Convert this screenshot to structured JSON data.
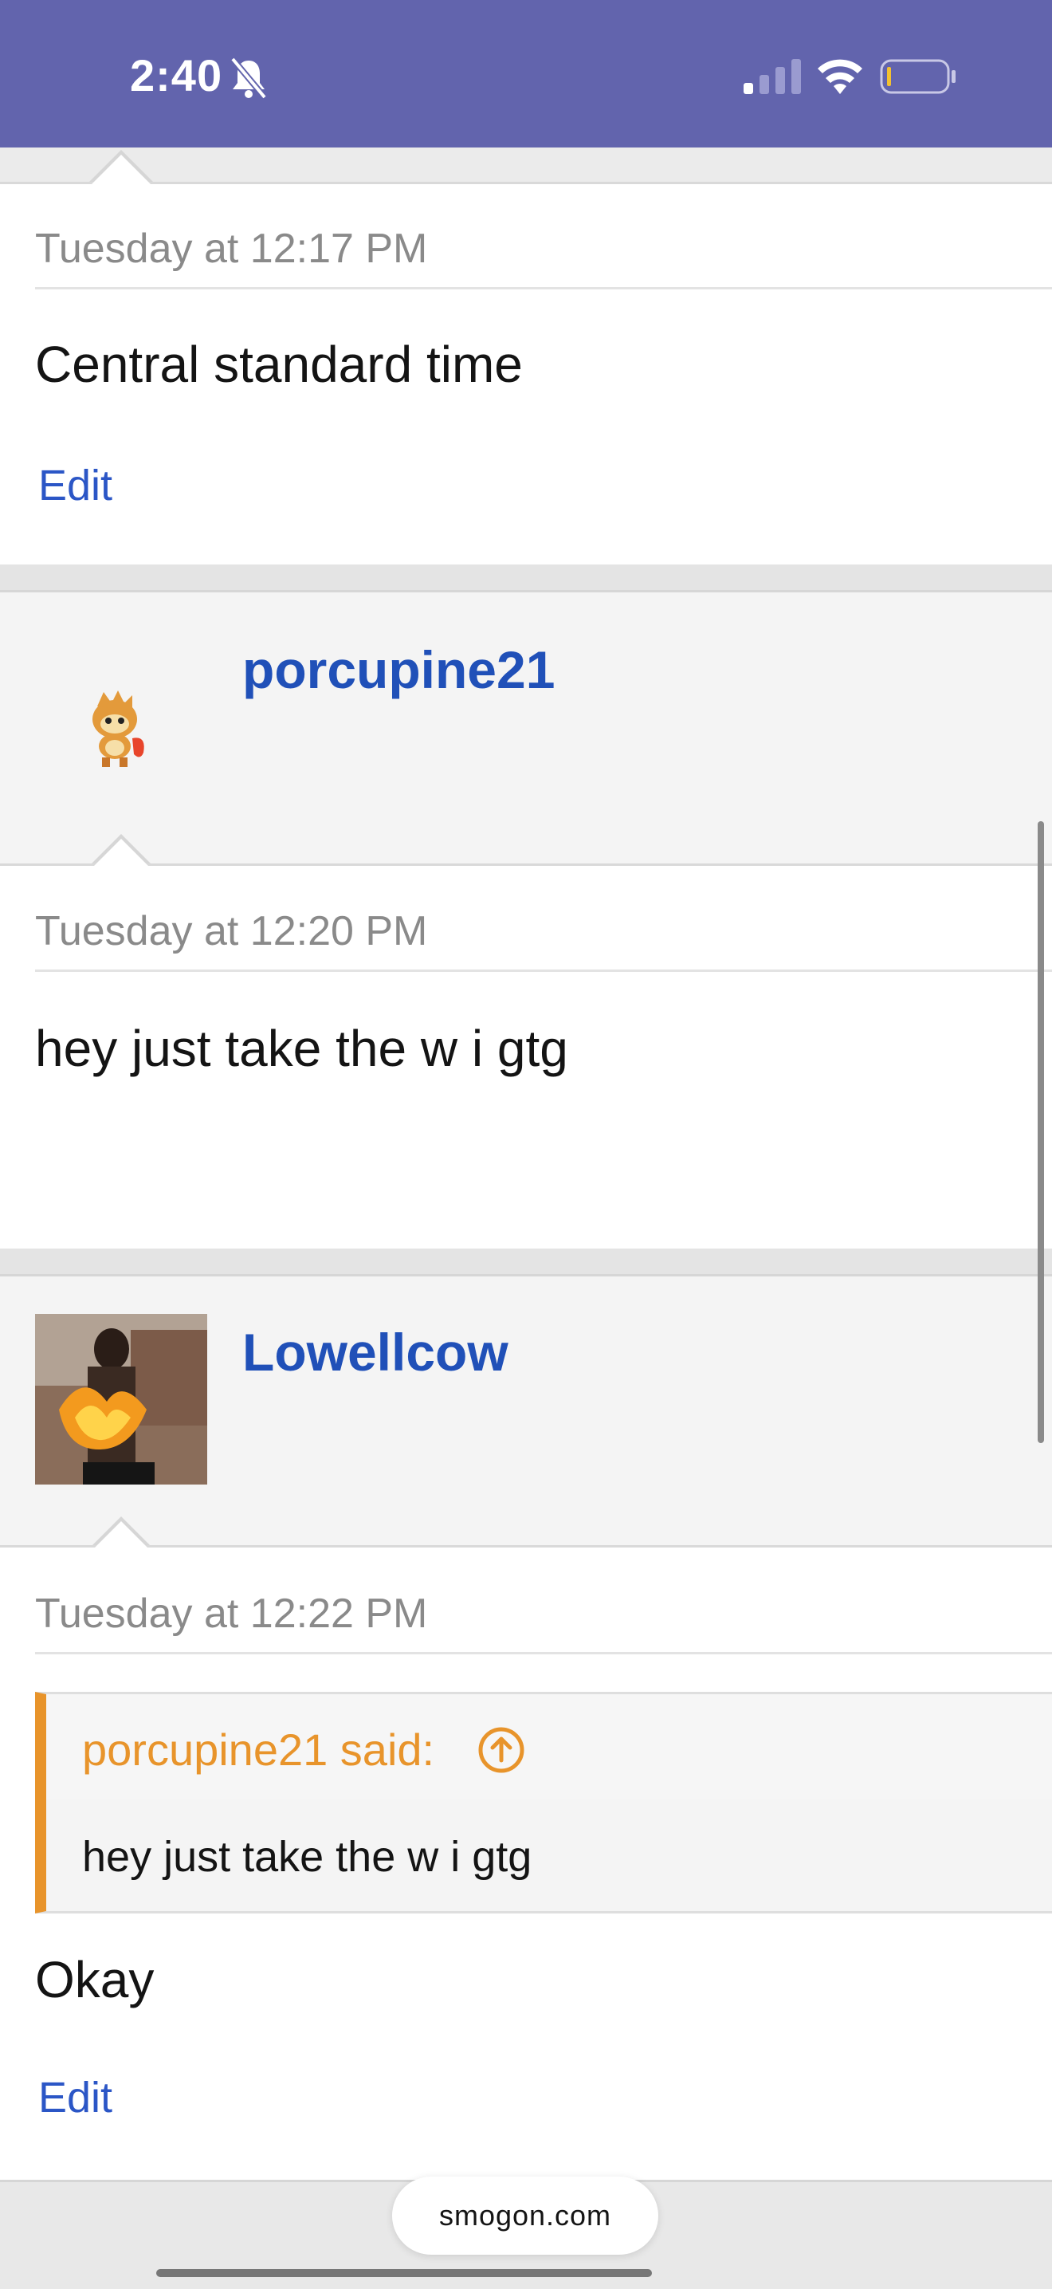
{
  "status_bar": {
    "time": "2:40"
  },
  "posts": [
    {
      "date": "Tuesday at 12:17 PM",
      "text": "Central standard time",
      "edit": "Edit"
    },
    {
      "author": "porcupine21",
      "date": "Tuesday at 12:20 PM",
      "text": "hey just take the w i gtg"
    },
    {
      "author": "Lowellcow",
      "date": "Tuesday at 12:22 PM",
      "quote": {
        "attribution": "porcupine21 said:",
        "text": "hey just take the w i gtg"
      },
      "text": "Okay",
      "edit": "Edit"
    }
  ],
  "browser": {
    "url": "smogon.com"
  },
  "colors": {
    "status_bar": "#6264ad",
    "link": "#2050b8",
    "quote_accent": "#e8942b"
  }
}
